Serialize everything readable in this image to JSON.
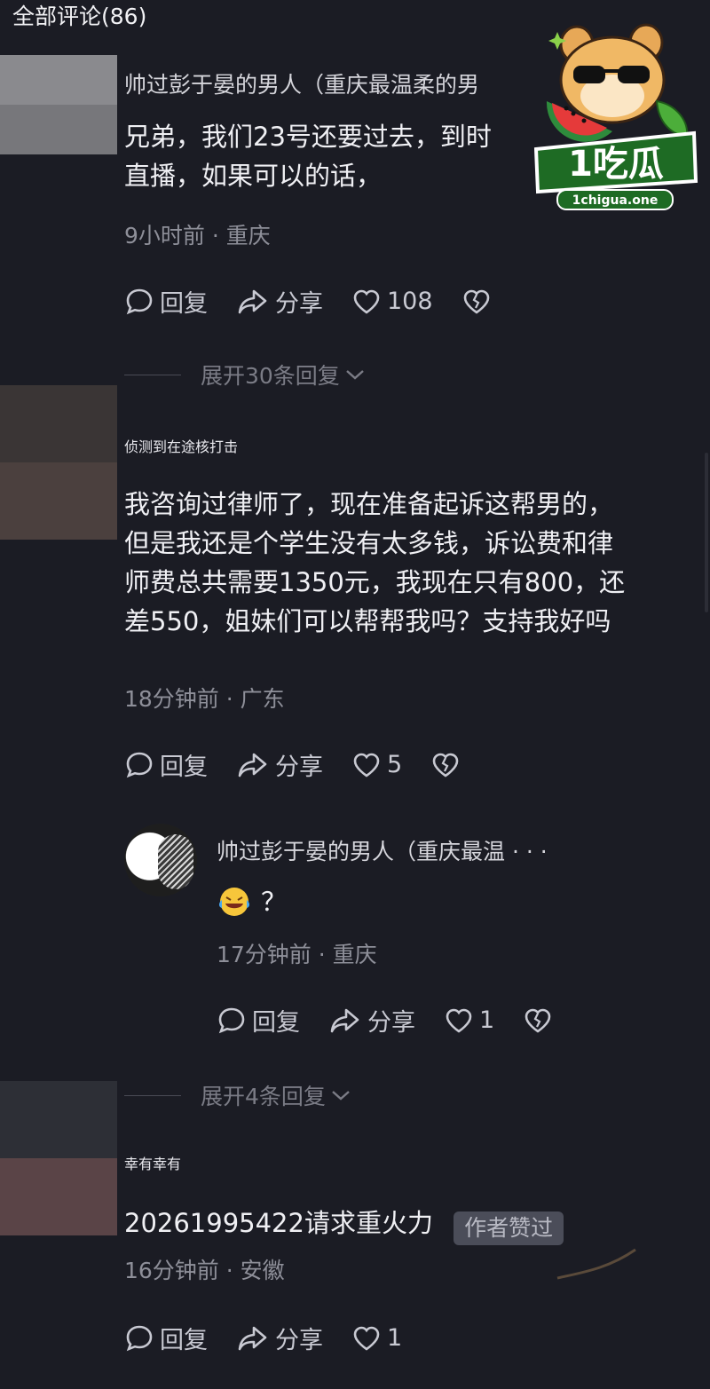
{
  "header": {
    "title": "全部评论(86)"
  },
  "watermark": {
    "brand": "1吃瓜",
    "url": "1chigua.one"
  },
  "comments": [
    {
      "author": "帅过彭于晏的男人（重庆最温柔的男",
      "text_lines": [
        "兄弟，我们23号还要过去，到时",
        "直播，如果可以的话，"
      ],
      "meta": "9小时前 · 重庆",
      "reply_label": "回复",
      "share_label": "分享",
      "like_count": "108",
      "expand_label": "展开30条回复"
    },
    {
      "author": "侦测到在途核打击",
      "text_lines": [
        "我咨询过律师了，现在准备起诉这帮男的，",
        "但是我还是个学生没有太多钱，诉讼费和律",
        "师费总共需要1350元，我现在只有800，还",
        "差550，姐妹们可以帮帮我吗？支持我好吗"
      ],
      "meta": "18分钟前 · 广东",
      "reply_label": "回复",
      "share_label": "分享",
      "like_count": "5",
      "reply": {
        "author": "帅过彭于晏的男人（重庆最温 · · ·",
        "text": "？",
        "meta": "17分钟前 · 重庆",
        "reply_label": "回复",
        "share_label": "分享",
        "like_count": "1"
      },
      "expand_label": "展开4条回复"
    },
    {
      "author": "幸有幸有",
      "text": "20261995422请求重火力",
      "badge": "作者赞过",
      "meta": "16分钟前 · 安徽",
      "reply_label": "回复",
      "share_label": "分享",
      "like_count": "1"
    }
  ],
  "colors": {
    "background": "#1b1c24",
    "text": "#f0f0f4",
    "muted": "#8e8f99"
  }
}
